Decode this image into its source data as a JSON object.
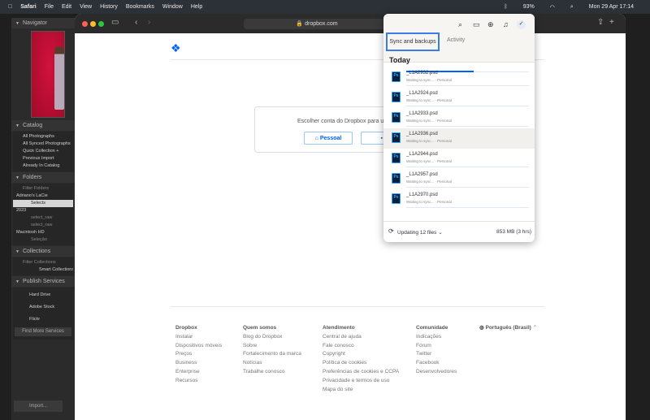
{
  "menubar": {
    "app": "Safari",
    "items": [
      "File",
      "Edit",
      "View",
      "History",
      "Bookmarks",
      "Window",
      "Help"
    ],
    "battery": "93%",
    "datetime": "Mon 29 Apr  17:14"
  },
  "lightroom": {
    "navigator": "Navigator",
    "catalog": {
      "title": "Catalog",
      "items": [
        "All Photographs",
        "All Synced Photographs",
        "Quick Collection +",
        "Previous Import",
        "Already In Catalog"
      ]
    },
    "folders": {
      "title": "Folders",
      "filter_placeholder": "Filter Folders",
      "items": [
        "Adriano's LaCie",
        "Selects",
        "2023",
        "select_raw",
        "select_raw",
        "Macintosh HD",
        "Seleção"
      ]
    },
    "collections": {
      "title": "Collections",
      "filter_placeholder": "Filter Collections",
      "items": [
        "Smart Collections"
      ]
    },
    "publish": {
      "title": "Publish Services",
      "items": [
        "Hard Drive",
        "Adobe Stock",
        "Flickr"
      ],
      "find_more": "Find More Services"
    },
    "import_button": "Import..."
  },
  "safari": {
    "url": "dropbox.com"
  },
  "dropbox_page": {
    "prompt": "Escolher conta do Dropbox para usar",
    "buttons": [
      "Pessoal",
      "Vi"
    ],
    "footer": [
      {
        "title": "Dropbox",
        "links": [
          "Instalar",
          "Dispositivos móveis",
          "Preços",
          "Business",
          "Enterprise",
          "Recursos"
        ]
      },
      {
        "title": "Quem somos",
        "links": [
          "Blog do Dropbox",
          "Sobre",
          "Fortalecimento da marca",
          "Notícias",
          "Trabalhe conosco"
        ]
      },
      {
        "title": "Atendimento",
        "links": [
          "Central de ajuda",
          "Fale conosco",
          "Copyright",
          "Política de cookies",
          "Preferências de cookies e CCPA",
          "Privacidade e termos de uso",
          "Mapa do site"
        ]
      },
      {
        "title": "Comunidade",
        "links": [
          "Indicações",
          "Fórum",
          "Twitter",
          "Facebook",
          "Desenvolvedores"
        ]
      }
    ],
    "language": "Português (Brasil)"
  },
  "dropbox_popup": {
    "tabs": [
      "Sync and backups",
      "Activity"
    ],
    "section": "Today",
    "files": [
      {
        "name": "_L1A2932.psd",
        "status": "Waiting to sync... · Personal"
      },
      {
        "name": "_L1A2924.psd",
        "status": "Waiting to sync... · Personal"
      },
      {
        "name": "_L1A2933.psd",
        "status": "Waiting to sync... · Personal"
      },
      {
        "name": "_L1A2936.psd",
        "status": "Waiting to sync... · Personal"
      },
      {
        "name": "_L1A2944.psd",
        "status": "Waiting to sync... · Personal"
      },
      {
        "name": "_L1A2957.psd",
        "status": "Waiting to sync... · Personal"
      },
      {
        "name": "_L1A2970.psd",
        "status": "Waiting to sync... · Personal"
      }
    ],
    "ps_label": "Ps",
    "status": "Updating 12 files",
    "size": "853 MB (3 hrs)",
    "top_progress": 0.55
  }
}
